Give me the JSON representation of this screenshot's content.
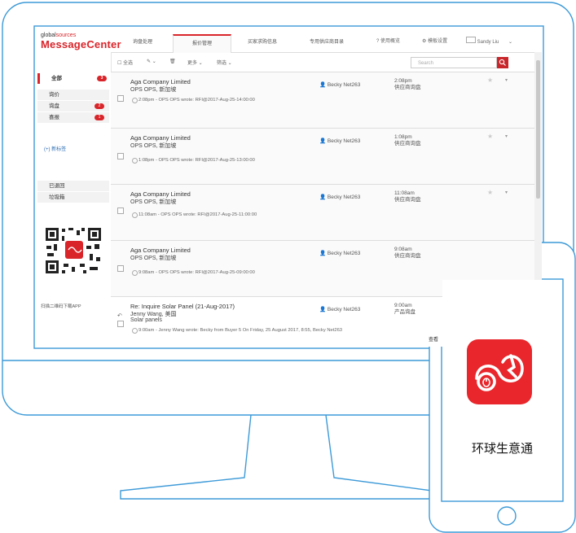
{
  "logo": {
    "small_prefix": "global",
    "small_accent": "sources",
    "title": "MessageCenter"
  },
  "tabs": [
    "询盘处理",
    "报价管理",
    "买家求购信息",
    "专用供应商目录"
  ],
  "topbar": {
    "help": "使用概览",
    "settings": "模板设置",
    "user": "Sandy Liu"
  },
  "sidebar": {
    "folders": [
      {
        "label": "全部",
        "badge": "3"
      },
      {
        "label": "询价",
        "badge": ""
      },
      {
        "label": "询盘",
        "badge": "2"
      },
      {
        "label": "喜报",
        "badge": "1"
      }
    ],
    "new_label": "(+) 新标签",
    "lower": [
      "已退回",
      "垃圾箱"
    ],
    "qr_caption": "扫描二维码下载APP"
  },
  "toolbar": {
    "select_all": "全选",
    "more": "更多",
    "filter": "筛选",
    "search_placeholder": "Search"
  },
  "messages": [
    {
      "company": "Aga Company Limited",
      "location": "OPS OPS, 新加坡",
      "person": "Becky Net263",
      "time": "2:08pm",
      "type": "供应商询盘",
      "snippet": "2:08pm - OPS OPS wrote: RFI@2017-Aug-25-14:00:00"
    },
    {
      "company": "Aga Company Limited",
      "location": "OPS OPS, 新加坡",
      "person": "Becky Net263",
      "time": "1:08pm",
      "type": "供应商询盘",
      "snippet": "1:08pm - OPS OPS wrote: RFI@2017-Aug-25-13:00:00"
    },
    {
      "company": "Aga Company Limited",
      "location": "OPS OPS, 新加坡",
      "person": "Becky Net263",
      "time": "11:08am",
      "type": "供应商询盘",
      "snippet": "11:08am - OPS OPS wrote: RFI@2017-Aug-25-11:00:00"
    },
    {
      "company": "Aga Company Limited",
      "location": "OPS OPS, 新加坡",
      "person": "Becky Net263",
      "time": "9:08am",
      "type": "供应商询盘",
      "snippet": "9:08am - OPS OPS wrote: RFI@2017-Aug-25-09:00:00"
    },
    {
      "company": "Re: Inquire Solar Panel (21-Aug-2017)",
      "location": "Jenny Wang, 美国",
      "extra": "Solar panels",
      "person": "Becky Net263",
      "time": "9:00am",
      "type": "产品询盘",
      "snippet": "9:00am - Jenny Wang wrote: Becky from Buyer 5 On Friday, 25 August 2017, 8:55, Becky Net263"
    }
  ],
  "partial_button": "查看",
  "app": {
    "name": "环球生意通"
  },
  "colors": {
    "brand_red": "#d9252a",
    "device_outline": "#3d9ad8"
  }
}
